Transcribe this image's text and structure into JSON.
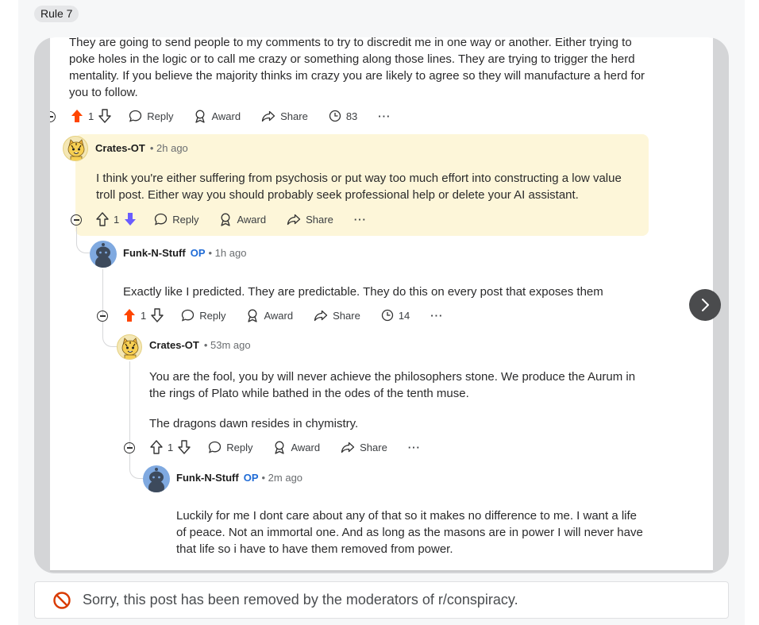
{
  "flair": "Rule 7",
  "colors": {
    "upvote_active": "#ff4500",
    "downvote_active": "#6a5cff",
    "op_badge": "#1f6bd6",
    "highlight_bg": "#fdf6d9",
    "removed_icon": "#d93a00"
  },
  "comments": [
    {
      "lines": [
        "They are going to send people to my comments to try to discredit me in one way or another. Either trying to",
        "poke holes in the logic or to call me crazy or something along those lines. They are trying to trigger the herd",
        "mentality. If you believe the majority thinks im crazy you are likely to agree so they will manufacture a herd for",
        "you to follow."
      ],
      "votes": "1",
      "reply": "Reply",
      "award": "Award",
      "share": "Share",
      "views": "83",
      "more": "···"
    },
    {
      "user": "Crates-OT",
      "time": "• 2h ago",
      "lines": [
        "I think you're either suffering from psychosis or put way too much effort into constructing a low value",
        "troll post. Either way you should probably seek professional help or delete your AI assistant."
      ],
      "votes": "1",
      "reply": "Reply",
      "award": "Award",
      "share": "Share",
      "more": "···"
    },
    {
      "user": "Funk-N-Stuff",
      "op": "OP",
      "time": "• 1h ago",
      "lines": [
        "Exactly like I predicted. They are predictable. They do this on every post that exposes them"
      ],
      "votes": "1",
      "reply": "Reply",
      "award": "Award",
      "share": "Share",
      "views": "14",
      "more": "···"
    },
    {
      "user": "Crates-OT",
      "time": "• 53m ago",
      "lines": [
        "You are the fool, you by will never achieve the philosophers stone. We produce the Aurum in",
        "the rings of Plato while bathed in the odes of the tenth muse."
      ],
      "line2": "The dragons dawn resides in chymistry.",
      "votes": "1",
      "reply": "Reply",
      "award": "Award",
      "share": "Share",
      "more": "···"
    },
    {
      "user": "Funk-N-Stuff",
      "op": "OP",
      "time": "• 2m ago",
      "lines": [
        "Luckily for me I dont care about any of that so it makes no difference to me. I want a life",
        "of peace. Not an immortal one. And as long as the masons are in power I will never have",
        "that life so i have to have them removed from power."
      ]
    }
  ],
  "gallery": {
    "slide_count": 5,
    "active_slide": 1
  },
  "removed_notice": "Sorry, this post has been removed by the moderators of r/conspiracy."
}
